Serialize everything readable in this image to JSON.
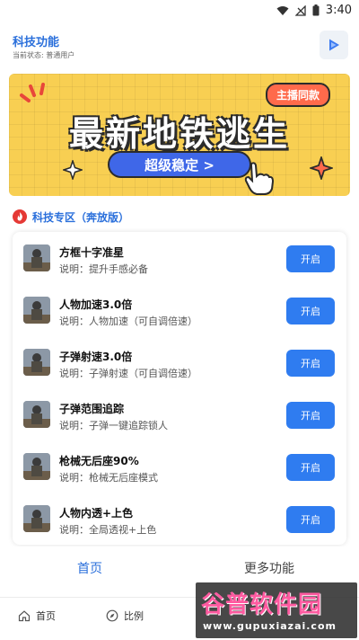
{
  "statusbar": {
    "time": "3:40",
    "icons": [
      "wifi-icon",
      "signal-icon",
      "battery-icon"
    ]
  },
  "header": {
    "title": "科技功能",
    "status": "当前状态: 普通用户",
    "play_icon": "play-icon"
  },
  "banner": {
    "badge": "主播同款",
    "title": "最新地铁逃生",
    "pill": "超级稳定 >"
  },
  "section": {
    "title": "科技专区（奔放版）",
    "icon": "fire-icon"
  },
  "features": [
    {
      "name": "方框十字准星",
      "desc": "说明：提升手感必备",
      "button": "开启"
    },
    {
      "name": "人物加速3.0倍",
      "desc": "说明：人物加速（可自调倍速）",
      "button": "开启"
    },
    {
      "name": "子弹射速3.0倍",
      "desc": "说明：子弹射速（可自调倍速）",
      "button": "开启"
    },
    {
      "name": "子弹范围追踪",
      "desc": "说明：子弹一键追踪锁人",
      "button": "开启"
    },
    {
      "name": "枪械无后座90%",
      "desc": "说明：枪械无后座模式",
      "button": "开启"
    },
    {
      "name": "人物内透+上色",
      "desc": "说明：全局透视+上色",
      "button": "开启"
    }
  ],
  "tabs": [
    {
      "label": "首页",
      "active": true
    },
    {
      "label": "更多功能",
      "active": false
    }
  ],
  "bottomnav": [
    {
      "label": "首页",
      "icon": "home-icon"
    },
    {
      "label": "比例",
      "icon": "compass-icon"
    }
  ],
  "watermark": {
    "main": "谷普软件园",
    "sub": "www.gupuxiazai.com"
  },
  "colors": {
    "accent": "#2a6fdb",
    "button": "#2f7cf0",
    "banner": "#f8cf52",
    "badge": "#ff6a4b"
  }
}
